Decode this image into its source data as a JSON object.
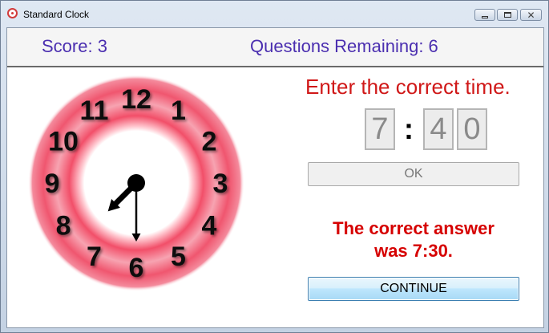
{
  "window": {
    "title": "Standard Clock",
    "minimize_glyph": "minimize-icon",
    "maximize_glyph": "maximize-icon",
    "close_label": "✕"
  },
  "header": {
    "score": "Score: 3",
    "questions_remaining": "Questions Remaining: 6"
  },
  "clock": {
    "numerals": [
      "12",
      "1",
      "2",
      "3",
      "4",
      "5",
      "6",
      "7",
      "8",
      "9",
      "10",
      "11"
    ],
    "hour": 7,
    "minute": 30,
    "ring_color": "#f0566f"
  },
  "quiz": {
    "prompt": "Enter the correct time.",
    "hour_value": "7",
    "colon": ":",
    "minute_tens_value": "4",
    "minute_ones_value": "0",
    "ok_label": "OK",
    "feedback_line1": "The correct answer",
    "feedback_line2": "was 7:30.",
    "continue_label": "CONTINUE"
  },
  "colors": {
    "header_text": "#4b2fb0",
    "prompt_text": "#d01818",
    "feedback_text": "#d60000"
  }
}
